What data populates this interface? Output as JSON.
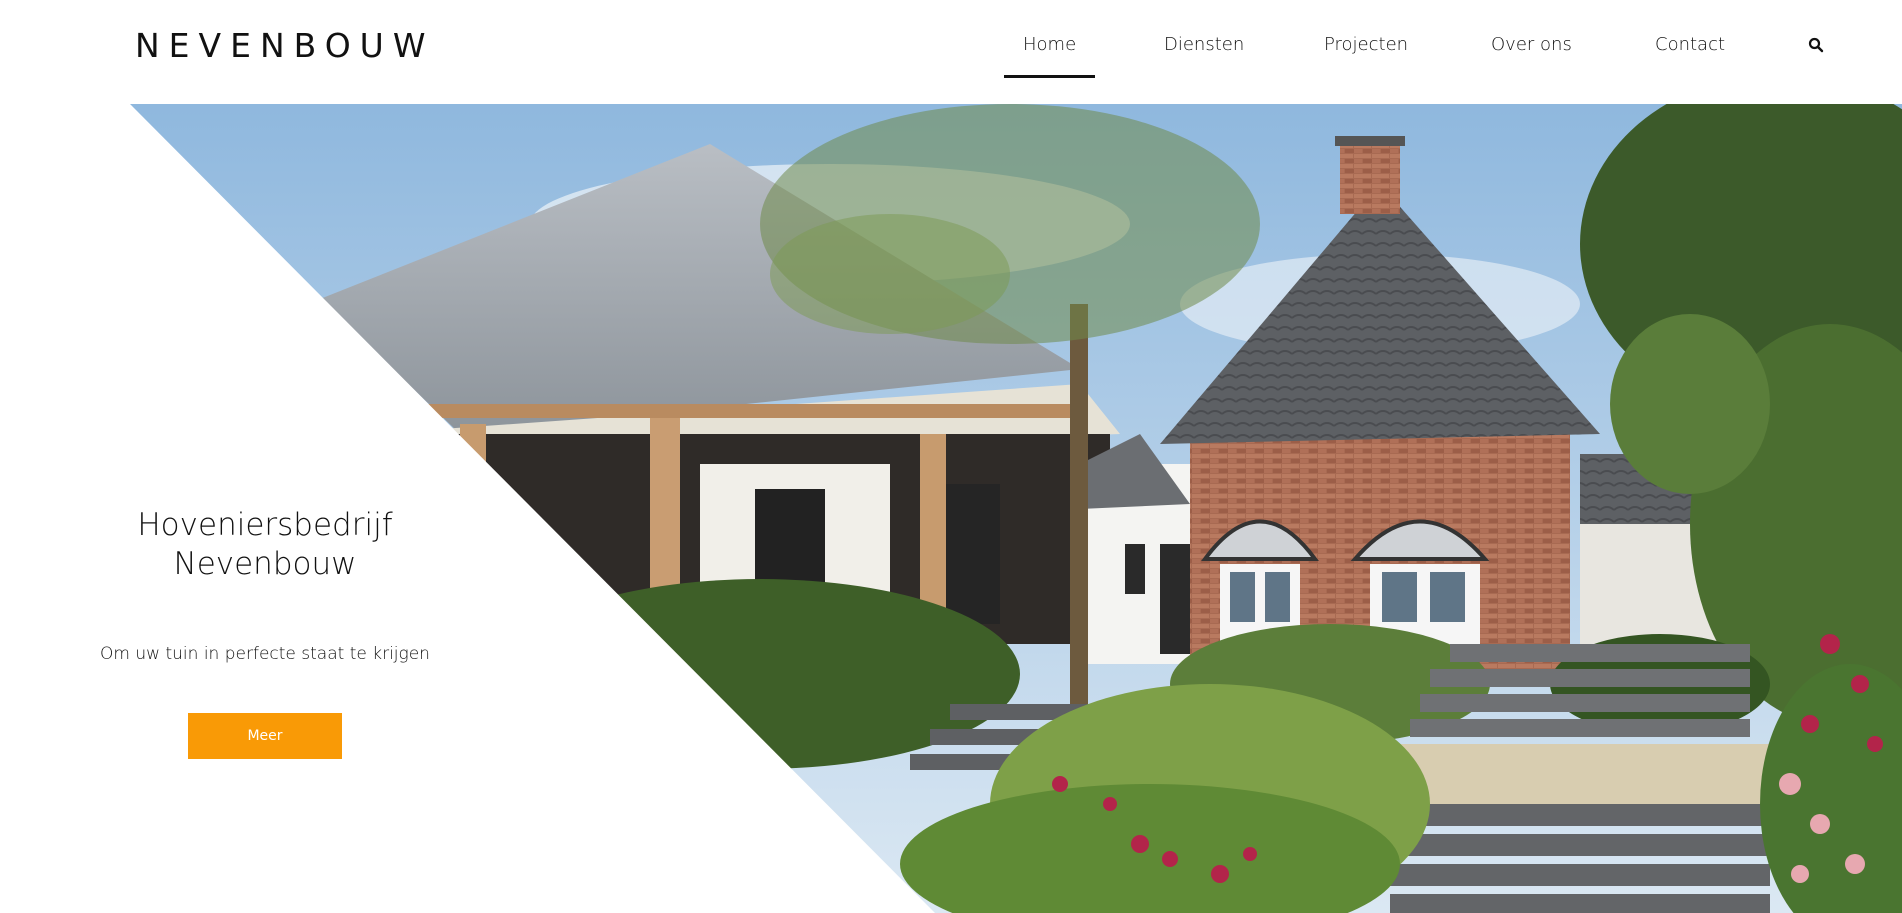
{
  "brand": {
    "logo_text": "NEVENBOUW"
  },
  "nav": {
    "items": [
      {
        "label": "Home",
        "active": true
      },
      {
        "label": "Diensten",
        "active": false
      },
      {
        "label": "Projecten",
        "active": false
      },
      {
        "label": "Over ons",
        "active": false
      },
      {
        "label": "Contact",
        "active": false
      }
    ],
    "search_icon": "search-icon"
  },
  "hero": {
    "title_line1": "Hoveniersbedrijf",
    "title_line2": "Nevenbouw",
    "subtitle": "Om uw tuin in perfecte staat te krijgen",
    "button_label": "Meer",
    "image_subject": "house-with-garden-photo"
  },
  "colors": {
    "accent": "#f99a06",
    "text": "#111111",
    "background": "#ffffff"
  }
}
